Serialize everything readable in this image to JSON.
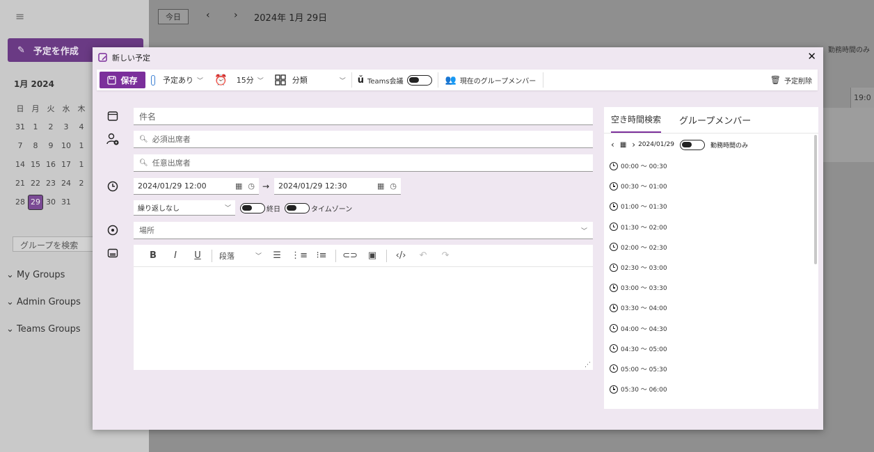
{
  "background": {
    "create_label": "予定を作成",
    "month_label": "1月 2024",
    "weekday_headers": [
      "日",
      "月",
      "火",
      "水",
      "木"
    ],
    "cal_rows": [
      [
        "31",
        "1",
        "2",
        "3",
        "4"
      ],
      [
        "7",
        "8",
        "9",
        "10",
        "1"
      ],
      [
        "14",
        "15",
        "16",
        "17",
        "1"
      ],
      [
        "21",
        "22",
        "23",
        "24",
        "2"
      ],
      [
        "28",
        "29",
        "30",
        "31",
        ""
      ]
    ],
    "selected_day": "29",
    "group_search_placeholder": "グループを検索",
    "groups": [
      "My Groups",
      "Admin Groups",
      "Teams Groups"
    ],
    "today_button": "今日",
    "current_date": "2024年 1月 29日",
    "work_hours_only": "勤務時間のみ",
    "hour_col": "19:0"
  },
  "dialog": {
    "title": "新しい予定",
    "toolbar": {
      "save": "保存",
      "status": "予定あり",
      "reminder": "15分",
      "category": "分類",
      "teams": "Teams会議",
      "group_members": "現在のグループメンバー",
      "delete": "予定削除"
    },
    "subject_placeholder": "件名",
    "required_placeholder": "必須出席者",
    "optional_placeholder": "任意出席者",
    "start": "2024/01/29 12:00",
    "end": "2024/01/29 12:30",
    "repeat": "繰り返しなし",
    "all_day": "終日",
    "timezone": "タイムゾーン",
    "location_placeholder": "場所",
    "editor": {
      "paragraph": "段落"
    },
    "right_panel": {
      "tab_free": "空き時間検索",
      "tab_members": "グループメンバー",
      "date": "2024/01/29",
      "work_hours_only": "勤務時間のみ",
      "slots": [
        "00:00 ～ 00:30",
        "00:30 ～ 01:00",
        "01:00 ～ 01:30",
        "01:30 ～ 02:00",
        "02:00 ～ 02:30",
        "02:30 ～ 03:00",
        "03:00 ～ 03:30",
        "03:30 ～ 04:00",
        "04:00 ～ 04:30",
        "04:30 ～ 05:00",
        "05:00 ～ 05:30",
        "05:30 ～ 06:00"
      ]
    }
  }
}
